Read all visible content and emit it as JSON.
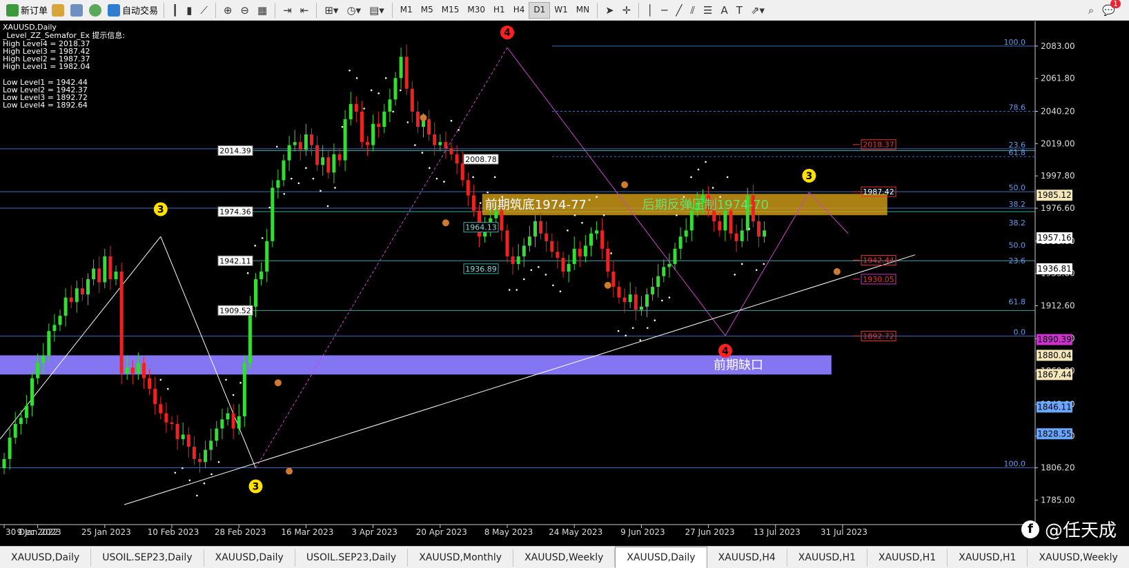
{
  "toolbar": {
    "new_order": "新订单",
    "auto_trade": "自动交易",
    "timeframes": [
      "M1",
      "M5",
      "M15",
      "M30",
      "H1",
      "H4",
      "D1",
      "W1",
      "MN"
    ],
    "active_timeframe": "D1",
    "notification_count": "1"
  },
  "chart_data": {
    "type": "candlestick",
    "symbol": "XAUUSD,Daily",
    "indicator": {
      "title": "_Level_ZZ_Semafor_Ex 提示信息:",
      "lines": [
        "High Level4 = 2018.37",
        "High Level3 = 1987.42",
        "High Level2 = 1987.37",
        "High Level1 = 1982.04",
        "Low Level1 = 1942.44",
        "Low Level2 = 1942.37",
        "Low Level3 = 1892.72",
        "Low Level4 = 1892.64"
      ]
    },
    "ylim": [
      1778,
      2092
    ],
    "y_ticks": [
      "2083.00",
      "2061.80",
      "2040.20",
      "2019.00",
      "1997.80",
      "1976.60",
      "1955.00",
      "1933.80",
      "1912.60",
      "1891.00",
      "1869.80",
      "1848.00",
      "1827.00",
      "1806.20",
      "1785.00"
    ],
    "x_ticks": [
      {
        "label": "30 Dec 2022",
        "bar": 0
      },
      {
        "label": "9 Jan 2023",
        "bar": 6
      },
      {
        "label": "25 Jan 2023",
        "bar": 18
      },
      {
        "label": "10 Feb 2023",
        "bar": 30
      },
      {
        "label": "28 Feb 2023",
        "bar": 42
      },
      {
        "label": "16 Mar 2023",
        "bar": 54
      },
      {
        "label": "3 Apr 2023",
        "bar": 66
      },
      {
        "label": "20 Apr 2023",
        "bar": 78
      },
      {
        "label": "8 May 2023",
        "bar": 90
      },
      {
        "label": "24 May 2023",
        "bar": 102
      },
      {
        "label": "9 Jun 2023",
        "bar": 114
      },
      {
        "label": "27 Jun 2023",
        "bar": 126
      },
      {
        "label": "13 Jul 2023",
        "bar": 138
      },
      {
        "label": "31 Jul 2023",
        "bar": 150
      }
    ],
    "close": [
      1812,
      1826,
      1835,
      1839,
      1847,
      1865,
      1875,
      1880,
      1896,
      1900,
      1906,
      1918,
      1915,
      1924,
      1920,
      1930,
      1937,
      1928,
      1945,
      1930,
      1935,
      1868,
      1872,
      1868,
      1875,
      1865,
      1858,
      1848,
      1842,
      1836,
      1835,
      1825,
      1828,
      1820,
      1812,
      1810,
      1818,
      1824,
      1832,
      1838,
      1842,
      1832,
      1840,
      1875,
      1912,
      1930,
      1935,
      1955,
      1990,
      1995,
      2008,
      2018,
      2020,
      2015,
      2025,
      2018,
      2005,
      2010,
      2000,
      2012,
      2008,
      2035,
      2045,
      2040,
      2020,
      2018,
      2032,
      2030,
      2040,
      2048,
      2062,
      2076,
      2055,
      2040,
      2030,
      2035,
      2025,
      2018,
      2020,
      2016,
      2012,
      2006,
      1995,
      1985,
      1975,
      1958,
      1965,
      1970,
      1975,
      1962,
      1945,
      1940,
      1945,
      1952,
      1958,
      1968,
      1960,
      1955,
      1948,
      1944,
      1935,
      1940,
      1950,
      1945,
      1952,
      1960,
      1962,
      1950,
      1935,
      1925,
      1918,
      1915,
      1920,
      1910,
      1912,
      1920,
      1925,
      1932,
      1938,
      1940,
      1950,
      1958,
      1962,
      1975,
      1980,
      1985,
      1975,
      1968,
      1962,
      1975,
      1960,
      1955,
      1962,
      1985,
      1968,
      1958,
      1962
    ],
    "series_names": [],
    "levels": [
      {
        "label": "2014.39",
        "y": 2014.39
      },
      {
        "label": "1974.36",
        "y": 1974.36
      },
      {
        "label": "1942.11",
        "y": 1942.11
      },
      {
        "label": "1909.52",
        "y": 1909.52
      },
      {
        "label": "2008.78",
        "y": 2008.78
      },
      {
        "label": "1964.13",
        "y": 1964.13
      },
      {
        "label": "1936.89",
        "y": 1936.89
      }
    ],
    "fib_right": [
      "100.0",
      "78.6",
      "61.8",
      "50.0",
      "38.2",
      "23.6",
      "0.0",
      "100.0"
    ],
    "fib_right_values": [
      2083,
      2040.2,
      2010.5,
      1987.42,
      1976.6,
      2015.6,
      1892.64,
      1806.2
    ],
    "fib_mid": [
      "38.2",
      "50.0",
      "23.6",
      "61.8"
    ],
    "fib_mid_values": [
      1964.5,
      1949.6,
      1939.5,
      1912.6
    ],
    "semafor_right": [
      "2018.37",
      "1987.42",
      "1942.44",
      "1930.05",
      "1892.72"
    ],
    "semafor_right_values": [
      2018.37,
      1987.42,
      1942.44,
      1930.05,
      1892.72
    ],
    "price_tags": [
      {
        "text": "1985.12",
        "value": 1985.12,
        "bg": "#f5e6b8"
      },
      {
        "text": "1957.16",
        "value": 1957.16,
        "bg": "#ffffff"
      },
      {
        "text": "1936.81",
        "value": 1936.81,
        "bg": "#ffffff"
      },
      {
        "text": "1890.39",
        "value": 1890.39,
        "bg": "#cc33cc"
      },
      {
        "text": "1880.04",
        "value": 1880.04,
        "bg": "#f5e6b8"
      },
      {
        "text": "1867.44",
        "value": 1867.44,
        "bg": "#f5e6b8"
      },
      {
        "text": "1846.11",
        "value": 1846.11,
        "bg": "#6aa8ff"
      },
      {
        "text": "1828.55",
        "value": 1828.55,
        "bg": "#6aa8ff"
      }
    ],
    "zones": [
      {
        "label": "前期筑底1974-77",
        "label2": "后期反弹压制1974-70",
        "y_top": 1986,
        "y_bottom": 1972,
        "from_bar": 88,
        "to_bar": 158,
        "color": "#d4a017"
      },
      {
        "label": "前期缺口",
        "y_top": 1880.04,
        "y_bottom": 1867.44,
        "from_bar": 0,
        "to_bar": 148,
        "color": "#8b7bff"
      }
    ],
    "markers": [
      {
        "text": "4",
        "bar": 90,
        "value": 2082,
        "color": "#ff2020",
        "place": "above"
      },
      {
        "text": "3",
        "bar": 28,
        "value": 1966,
        "color": "#ffe000",
        "place": "above"
      },
      {
        "text": "3",
        "bar": 45,
        "value": 1804,
        "color": "#ffe000",
        "place": "below"
      },
      {
        "text": "3",
        "bar": 144,
        "value": 1988,
        "color": "#ffe000",
        "place": "above"
      },
      {
        "text": "4",
        "bar": 129,
        "value": 1893,
        "color": "#ff2020",
        "place": "below"
      }
    ],
    "small_markers": [
      {
        "bar": 75,
        "value": 2036
      },
      {
        "bar": 79,
        "value": 1967
      },
      {
        "bar": 49,
        "value": 1862
      },
      {
        "bar": 51,
        "value": 1804
      },
      {
        "bar": 111,
        "value": 1992
      },
      {
        "bar": 108,
        "value": 1926
      },
      {
        "bar": 149,
        "value": 1935
      }
    ]
  },
  "tabs": [
    "XAUUSD,Daily",
    "USOIL.SEP23,Daily",
    "XAUUSD,Daily",
    "USOIL.SEP23,Daily",
    "XAUUSD,Monthly",
    "XAUUSD,Weekly",
    "XAUUSD,Daily",
    "XAUUSD,H4",
    "XAUUSD,H1",
    "XAUUSD,H1",
    "XAUUSD,H1",
    "XAUUSD,Weekly"
  ],
  "active_tab": 6,
  "watermark": "@任天成"
}
